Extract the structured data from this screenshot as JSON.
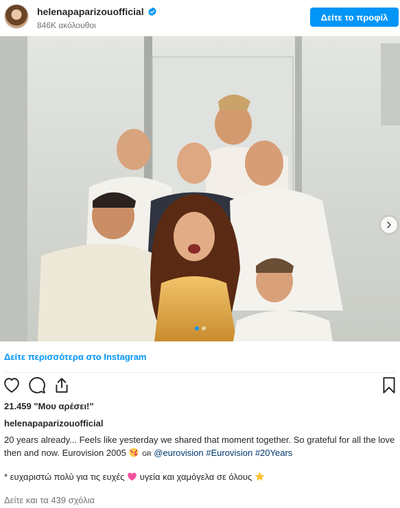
{
  "header": {
    "username": "helenapaparizouofficial",
    "followers": "846K ακόλουθοι",
    "profile_button": "Δείτε το προφίλ"
  },
  "post": {
    "see_more_link": "Δείτε περισσότερα στο Instagram",
    "likes": "21.459 \"Μου αρέσει!\"",
    "caption_user": "helenapaparizouofficial",
    "caption_line1": "20 years already... Feels like yesterday we shared that moment together. So grateful for all the love then and now. Eurovision 2005",
    "flag_text": "GR",
    "mention": "@eurovision",
    "hashtag1": "#Eurovision",
    "hashtag2": "#20Years",
    "greek_part1": "* ευχαριστώ πολύ για τις ευχές",
    "greek_part2": "υγεία και χαμόγελα σε όλους",
    "view_comments": "Δείτε και τα 439 σχόλια"
  },
  "icons": [
    "avatar",
    "verified-icon",
    "chevron-right-icon",
    "heart-icon",
    "comment-icon",
    "share-icon",
    "bookmark-icon",
    "kiss-emoji-icon",
    "pink-heart-emoji-icon",
    "star-emoji-icon"
  ],
  "colors": {
    "accent": "#0095f6",
    "link": "#00376b",
    "muted": "#737373"
  }
}
